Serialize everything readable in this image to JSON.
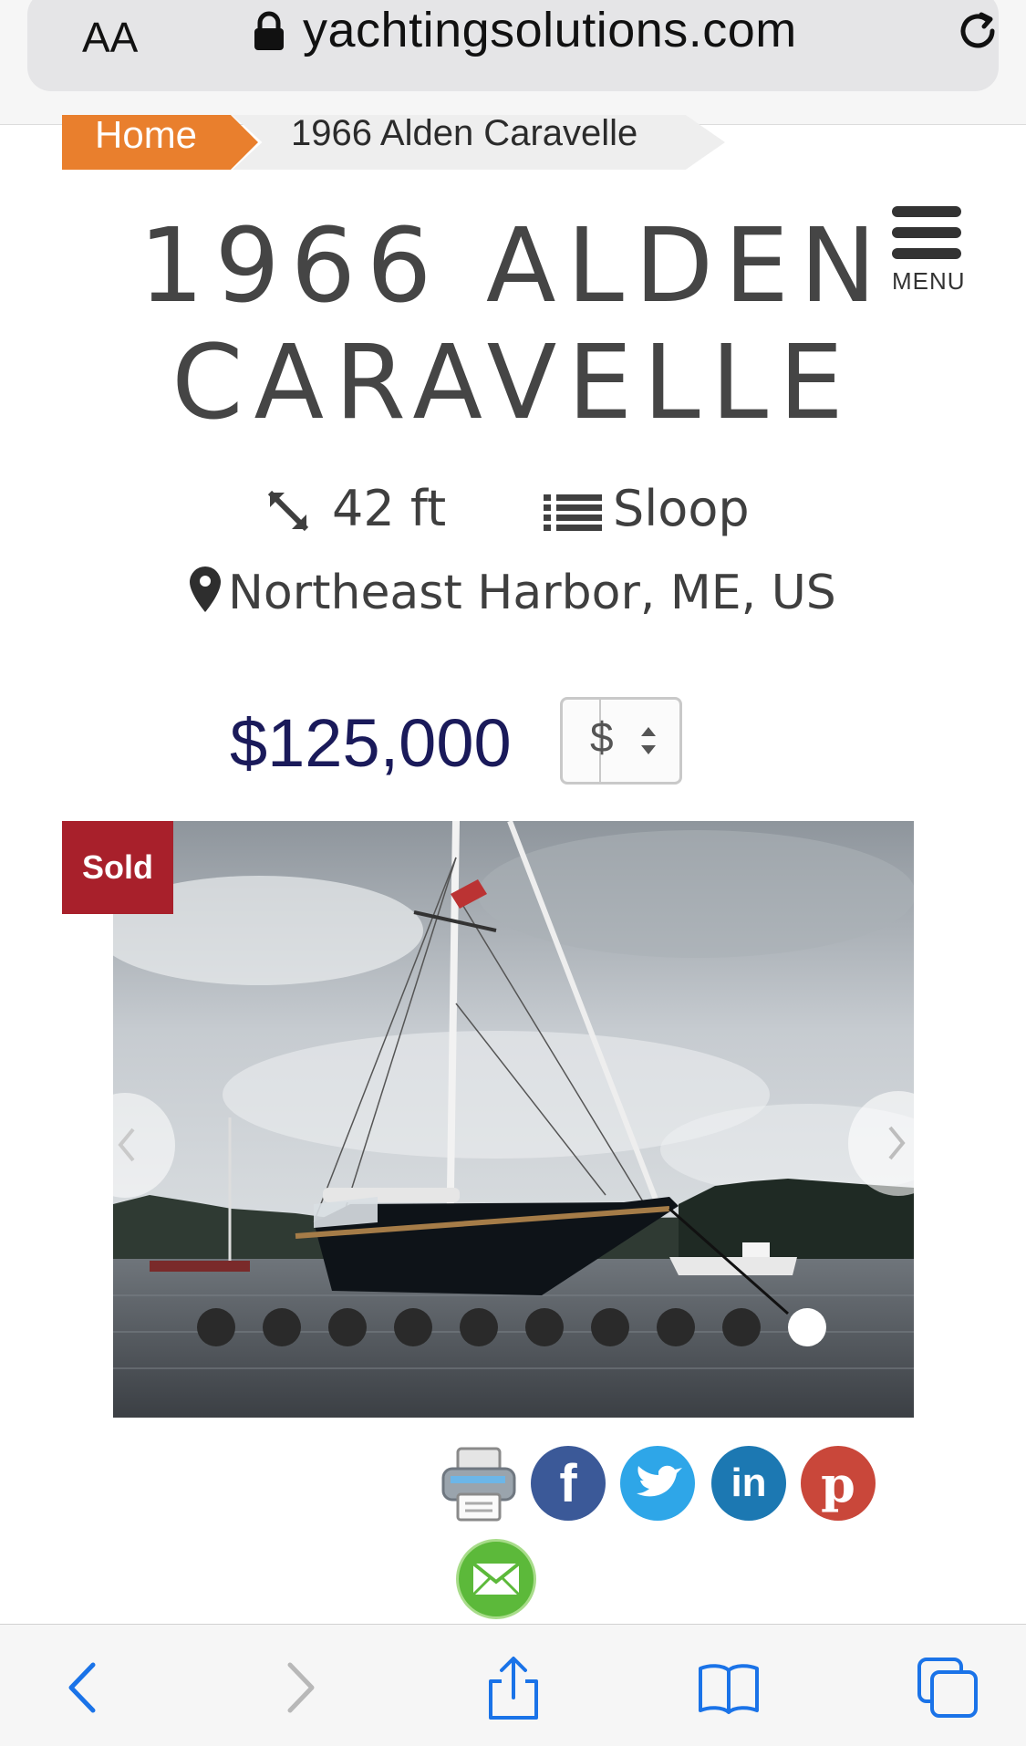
{
  "browser": {
    "text_size_label": "AA",
    "url": "yachtingsolutions.com"
  },
  "breadcrumb": {
    "home": "Home",
    "current": "1966 Alden Caravelle"
  },
  "menu": {
    "label": "MENU"
  },
  "listing": {
    "title_line1": "1966 ALDEN",
    "title_line2": "CARAVELLE",
    "length": "42 ft",
    "type": "Sloop",
    "location": "Northeast Harbor, ME, US",
    "price": "$125,000",
    "currency": "$",
    "status": "Sold"
  },
  "gallery": {
    "slide_count": 10,
    "active_index": 9
  },
  "share": {
    "icons": [
      "print-icon",
      "facebook-icon",
      "twitter-icon",
      "linkedin-icon",
      "pinterest-icon",
      "email-icon"
    ]
  },
  "colors": {
    "breadcrumb_home": "#e97f2d",
    "price": "#1a1a5a",
    "sold_badge": "#a8202b",
    "ios_blue": "#1a73e8"
  }
}
